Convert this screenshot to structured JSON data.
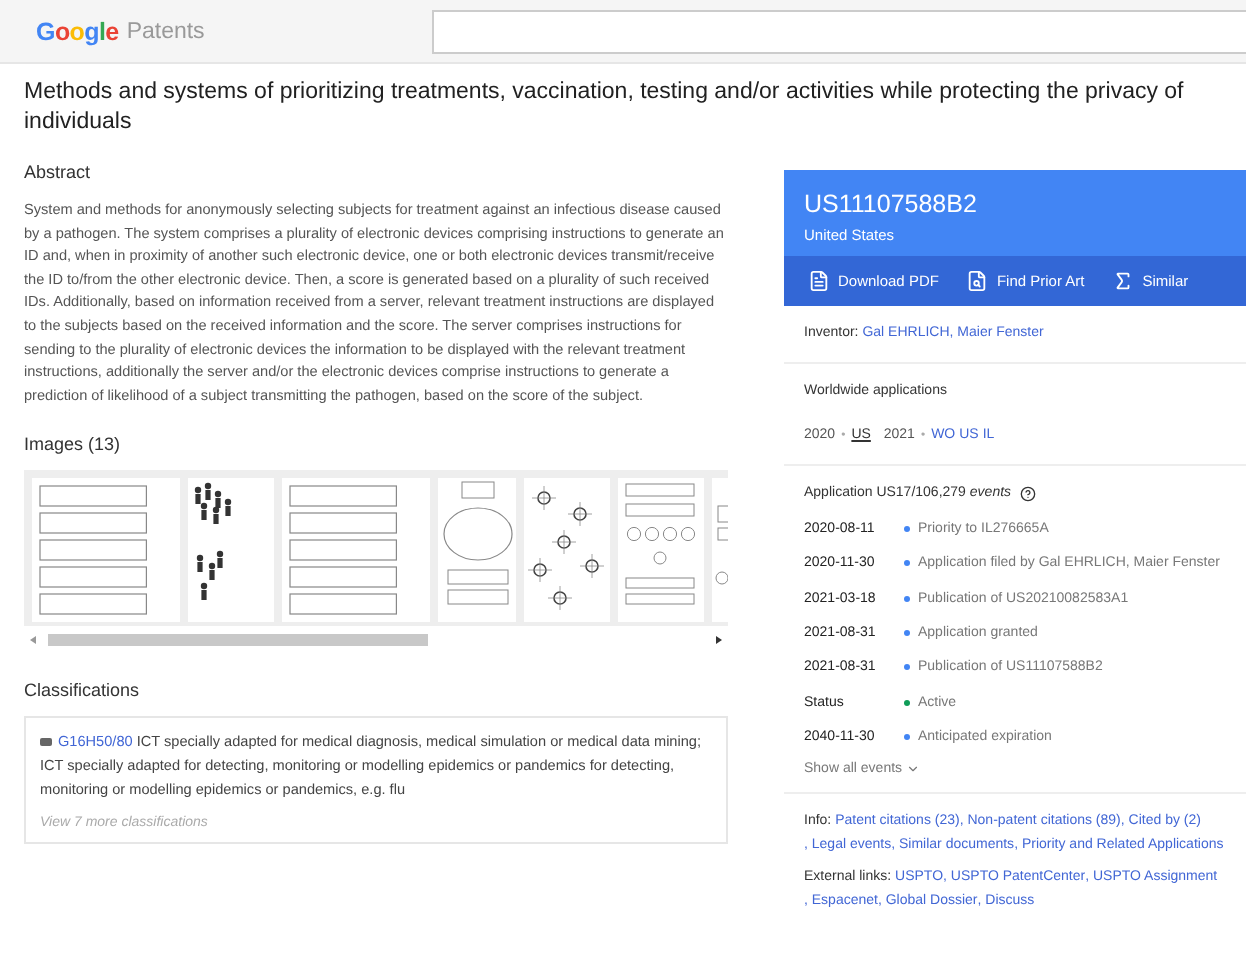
{
  "header": {
    "logo": "Google",
    "product": "Patents"
  },
  "title": "Methods and systems of prioritizing treatments, vaccination, testing and/or activities while protecting the privacy of individuals",
  "abstract": {
    "heading": "Abstract",
    "text": "System and methods for anonymously selecting subjects for treatment against an infectious disease caused by a pathogen. The system comprises a plurality of electronic devices comprising instructions to generate an ID and, when in proximity of another such electronic device, one or both electronic devices transmit/receive the ID to/from the other electronic device. Then, a score is generated based on a plurality of such received IDs. Additionally, based on information received from a server, relevant treatment instructions are displayed to the subjects based on the received information and the score. The server comprises instructions for sending to the plurality of electronic devices the information to be displayed with the relevant treatment instructions, additionally the server and/or the electronic devices comprise instructions to generate a prediction of likelihood of a subject transmitting the pathogen, based on the score of the subject."
  },
  "images": {
    "heading": "Images (13)",
    "thumbnails": [
      {
        "kind": "flowchart"
      },
      {
        "kind": "people"
      },
      {
        "kind": "flowchart"
      },
      {
        "kind": "diagram"
      },
      {
        "kind": "network"
      },
      {
        "kind": "tree"
      },
      {
        "kind": "decision"
      }
    ]
  },
  "classifications": {
    "heading": "Classifications",
    "code": "G16H50/80",
    "description": "ICT specially adapted for medical diagnosis, medical simulation or medical data mining; ICT specially adapted for detecting, monitoring or modelling epidemics or pandemics for detecting, monitoring or modelling epidemics or pandemics, e.g. flu",
    "more": "View 7 more classifications"
  },
  "patent_card": {
    "number": "US11107588B2",
    "country": "United States",
    "actions": [
      {
        "kind": "pdf",
        "label": "Download PDF"
      },
      {
        "kind": "prior_art",
        "label": "Find Prior Art"
      },
      {
        "kind": "similar",
        "label": "Similar"
      }
    ]
  },
  "inventor": {
    "label": "Inventor:",
    "names": [
      "Gal EHRLICH",
      ", Maier Fenster"
    ]
  },
  "worldwide": {
    "heading": "Worldwide applications",
    "separator": "•",
    "years": [
      {
        "year": "2020",
        "countries": [
          {
            "code": "US",
            "selected": true
          }
        ]
      },
      {
        "year": "2021",
        "countries": [
          {
            "code": "WO",
            "selected": false
          },
          {
            "code": "US",
            "selected": false
          },
          {
            "code": "IL",
            "selected": false
          }
        ]
      }
    ]
  },
  "events": {
    "heading": "Application US17/106,279 *events*",
    "items": [
      {
        "date": "2020-08-11",
        "text": "Priority to IL276665A",
        "color": "#4285f4"
      },
      {
        "date": "2020-11-30",
        "text": "Application filed by Gal EHRLICH, Maier Fenster",
        "color": "#4285f4"
      },
      {
        "date": "2021-03-18",
        "text": "Publication of US20210082583A1",
        "color": "#4285f4"
      },
      {
        "date": "2021-08-31",
        "text": "Application granted",
        "color": "#4285f4"
      },
      {
        "date": "2021-08-31",
        "text": "Publication of US11107588B2",
        "color": "#4285f4"
      },
      {
        "date": "Status",
        "text": "Active",
        "color": "#0f9d58"
      },
      {
        "date": "2040-11-30",
        "text": "Anticipated expiration",
        "color": "#4285f4"
      }
    ],
    "show_all": "Show all events"
  },
  "info": {
    "label": "Info:",
    "links": [
      "Patent citations (23)",
      ", Non-patent citations (89)",
      ", Cited by (2)",
      ", Legal events",
      ", Similar documents",
      ", Priority and Related Applications"
    ]
  },
  "external": {
    "label": "External links:",
    "links": [
      "USPTO",
      ", USPTO PatentCenter",
      ", USPTO Assignment",
      ", Espacenet",
      ", Global Dossier",
      ", Discuss"
    ]
  }
}
